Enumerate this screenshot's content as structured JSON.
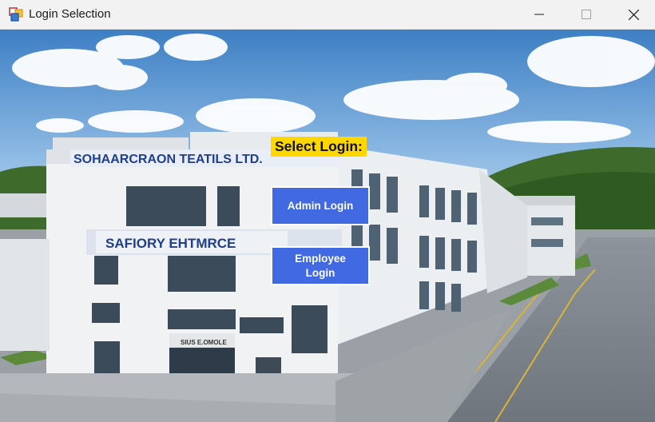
{
  "window": {
    "title": "Login Selection",
    "icon": "winforms-app-icon",
    "controls": {
      "minimize": "minimize-icon",
      "maximize": "maximize-icon",
      "close": "close-icon"
    }
  },
  "background": {
    "signs": {
      "company": "SOHAARCRAON TEATILS LTD.",
      "factory": "SAFIORY EHTMRCE",
      "small": "SIUS E.OMOLE"
    }
  },
  "content": {
    "heading": "Select Login:",
    "admin_button": "Admin Login",
    "employee_button": "Employee Login"
  },
  "colors": {
    "label_bg": "#ffd700",
    "button_bg": "#4169e1",
    "button_text": "#ffffff"
  }
}
